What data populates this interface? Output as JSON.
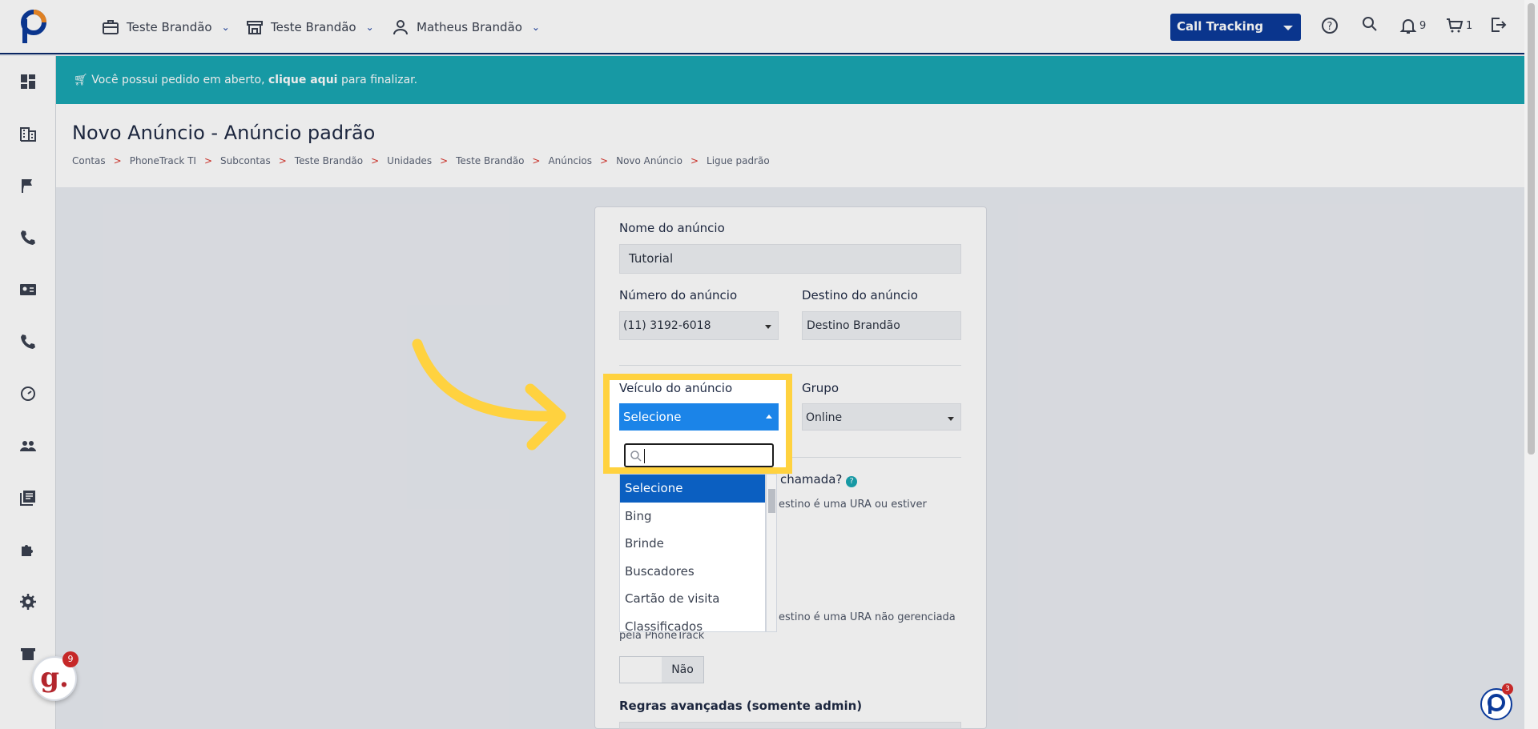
{
  "header": {
    "menu": [
      {
        "label": "Teste Brandão",
        "icon": "briefcase-icon"
      },
      {
        "label": "Teste Brandão",
        "icon": "store-icon"
      },
      {
        "label": "Matheus Brandão",
        "icon": "user-icon"
      }
    ],
    "product_select": "Call Tracking",
    "notifications_count": "9",
    "cart_count": "1"
  },
  "sidebar": {
    "icons": [
      "dashboard-icon",
      "building-icon",
      "flag-icon",
      "phone-icon",
      "contact-card-icon",
      "phone-alt-icon",
      "speedometer-icon",
      "users-icon",
      "library-icon",
      "puzzle-icon",
      "settings-icon",
      "store-icon"
    ]
  },
  "banner": {
    "text_before": "Você possui pedido em aberto,",
    "link": "clique aqui",
    "text_after": "para finalizar."
  },
  "page": {
    "title": "Novo Anúncio - Anúncio padrão",
    "breadcrumb": [
      "Contas",
      "PhoneTrack TI",
      "Subcontas",
      "Teste Brandão",
      "Unidades",
      "Teste Brandão",
      "Anúncios",
      "Novo Anúncio",
      "Ligue padrão"
    ]
  },
  "form": {
    "name_label": "Nome do anúncio",
    "name_value": "Tutorial",
    "number_label": "Número do anúncio",
    "number_value": "(11) 3192-6018",
    "destination_label": "Destino do anúncio",
    "destination_value": "Destino Brandão",
    "vehicle_label": "Veículo do anúncio",
    "vehicle_value": "Selecione",
    "group_label": "Grupo",
    "group_value": "Online",
    "question_label": "a chamada?",
    "hint1": "estino é uma URA ou estiver",
    "hint2": "estino é uma URA não gerenciada",
    "hint2b": "pela PhoneTrack",
    "toggle_value": "Não",
    "advanced_label": "Regras avançadas (somente admin)"
  },
  "dropdown": {
    "options": [
      "Selecione",
      "Bing",
      "Brinde",
      "Buscadores",
      "Cartão de visita",
      "Classificados"
    ],
    "selected_index": 0
  },
  "widgets": {
    "g_badge": "9",
    "p_badge": "3"
  },
  "colors": {
    "primary": "#0b3a9a",
    "banner": "#1aa6b2",
    "highlight": "#ffd23f",
    "select_active": "#1b84e8"
  }
}
